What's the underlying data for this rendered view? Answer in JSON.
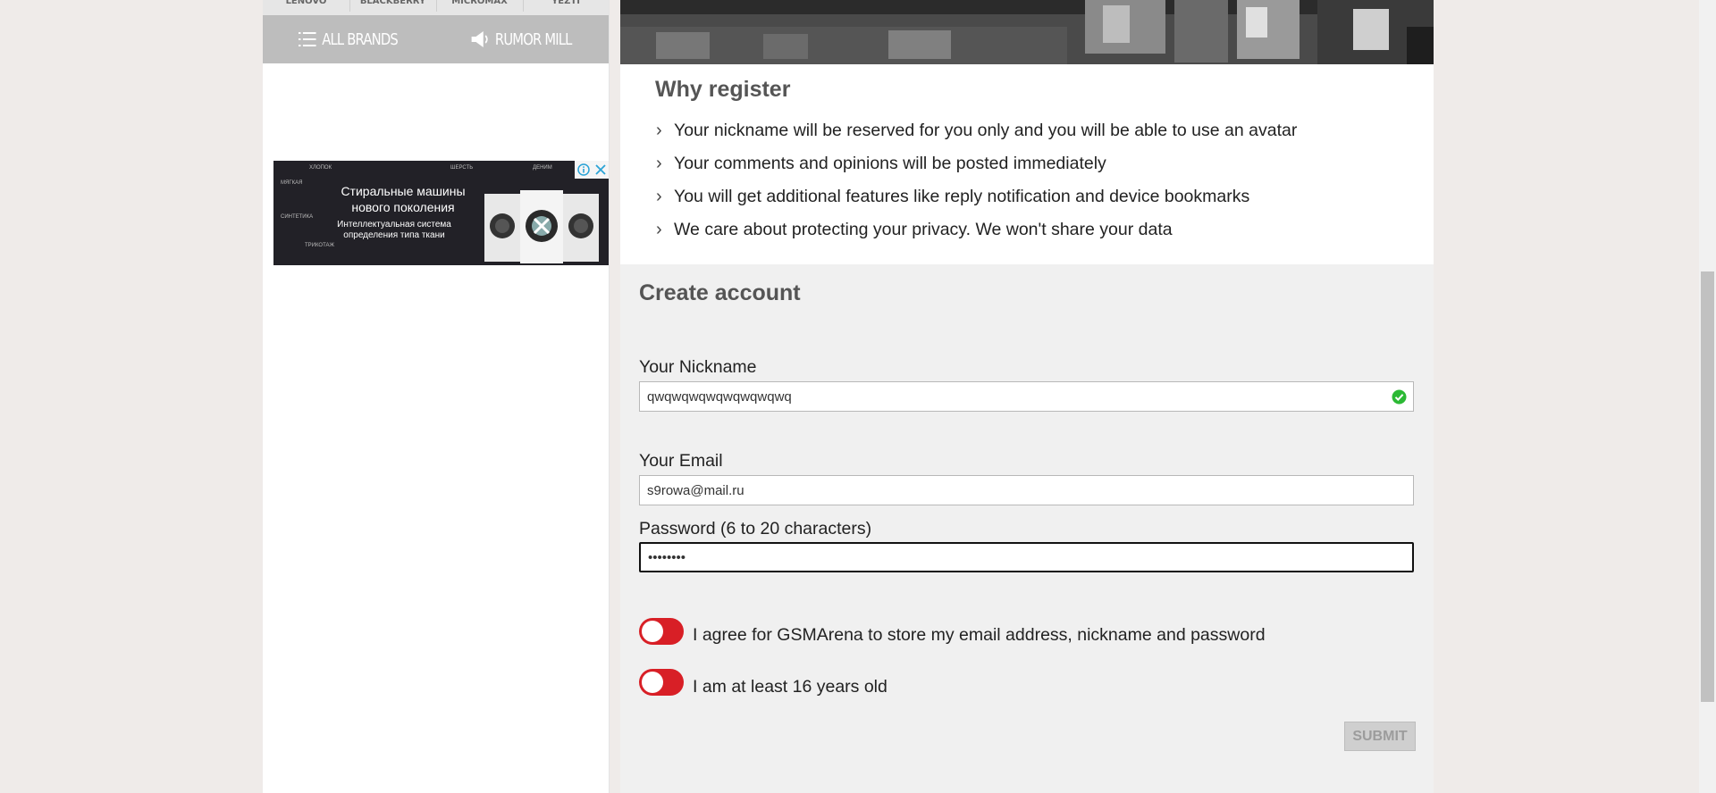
{
  "sidebar": {
    "brands": [
      "LENOVO",
      "BLACKBERRY",
      "MICROMAX",
      "YEZTI"
    ],
    "quicklinks": [
      {
        "label": "ALL BRANDS",
        "icon": "list-icon"
      },
      {
        "label": "RUMOR MILL",
        "icon": "megaphone-icon"
      }
    ],
    "ad": {
      "title": "Стиральные машины нового поколения",
      "subtitle": "Интеллектуальная система определения типа ткани",
      "small_labels": [
        "ХЛОПОК",
        "ШЕРСТЬ",
        "СИНТЕТИКА",
        "ДЕНИМ",
        "ТРИКОТАЖ",
        "МЯГКАЯ"
      ],
      "badge_icons": [
        "info-icon",
        "close-icon"
      ]
    }
  },
  "why_register": {
    "title": "Why register",
    "items": [
      "Your nickname will be reserved for you only and you will be able to use an avatar",
      "Your comments and opinions will be posted immediately",
      "You will get additional features like reply notification and device bookmarks",
      "We care about protecting your privacy. We won't share your data"
    ]
  },
  "create_account": {
    "title": "Create account",
    "nickname_label": "Your Nickname",
    "nickname_value": "qwqwqwqwqwqwqwqwq",
    "email_label": "Your Email",
    "email_value": "s9rowa@mail.ru",
    "password_label": "Password (6 to 20 characters)",
    "password_value": "12345678",
    "agree_label": "I agree for GSMArena to store my email address, nickname and password",
    "age_label": "I am at least 16 years old",
    "submit_label": "SUBMIT"
  },
  "colors": {
    "accent": "#d81f26",
    "valid": "#2bb934",
    "background": "#efebe9"
  }
}
